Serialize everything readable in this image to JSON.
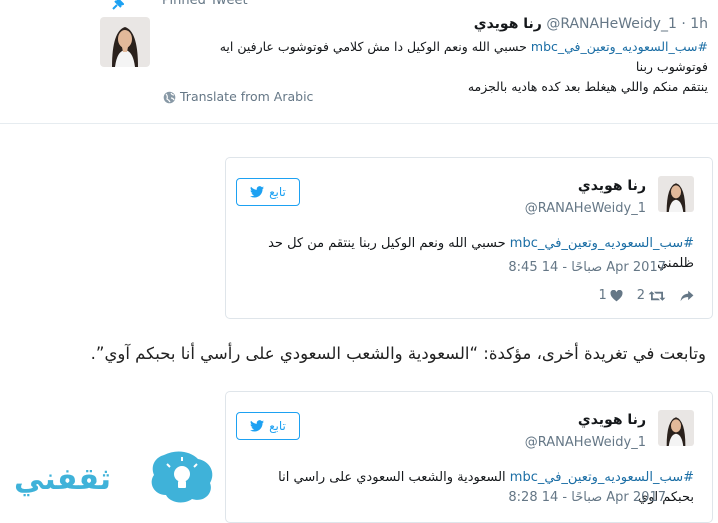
{
  "pinned": {
    "label": "Pinned Tweet",
    "author_name": "رنا هويدي",
    "handle": "@RANAHeWeidy_1",
    "time": "· 1h",
    "hashtag": "#سب_السعوديه_وتعين_في_mbc",
    "text_line1": " حسبي الله ونعم الوكيل دا مش كلامي فوتوشوب عارفين ايه  فوتوشوب ربنا",
    "text_line2": "ينتقم منكم واللي هيغلط بعد كده هاديه بالجزمه",
    "translate": "Translate from Arabic"
  },
  "embeds": [
    {
      "author_name": "رنا هويدي",
      "handle": "@RANAHeWeidy_1",
      "follow_label": "تابع",
      "hashtag": "#سب_السعوديه_وتعين_في_mbc",
      "text": " حسبي الله ونعم الوكيل ربنا ينتقم من كل حد ظلمني",
      "date": "8:45 صباحًا - 14 Apr 2017",
      "likes": "1",
      "retweets": "2"
    },
    {
      "author_name": "رنا هويدي",
      "handle": "@RANAHeWeidy_1",
      "follow_label": "تابع",
      "hashtag": "#سب_السعوديه_وتعين_في_mbc",
      "text": " السعودية والشعب السعودي على راسي انا بحبكم اوي",
      "date": "8:28 صباحًا - 14 Apr 2017"
    }
  ],
  "article": {
    "paragraph": "وتابعت في تغريدة أخرى، مؤكدة: “السعودية والشعب السعودي على رأسي أنا بحبكم آوي”."
  },
  "watermark": {
    "logo_text": "ثقفني"
  },
  "colors": {
    "link": "#1b6ea5",
    "twitter_blue": "#1da1f2",
    "muted": "#657786",
    "logo": "#3fb2d9"
  }
}
